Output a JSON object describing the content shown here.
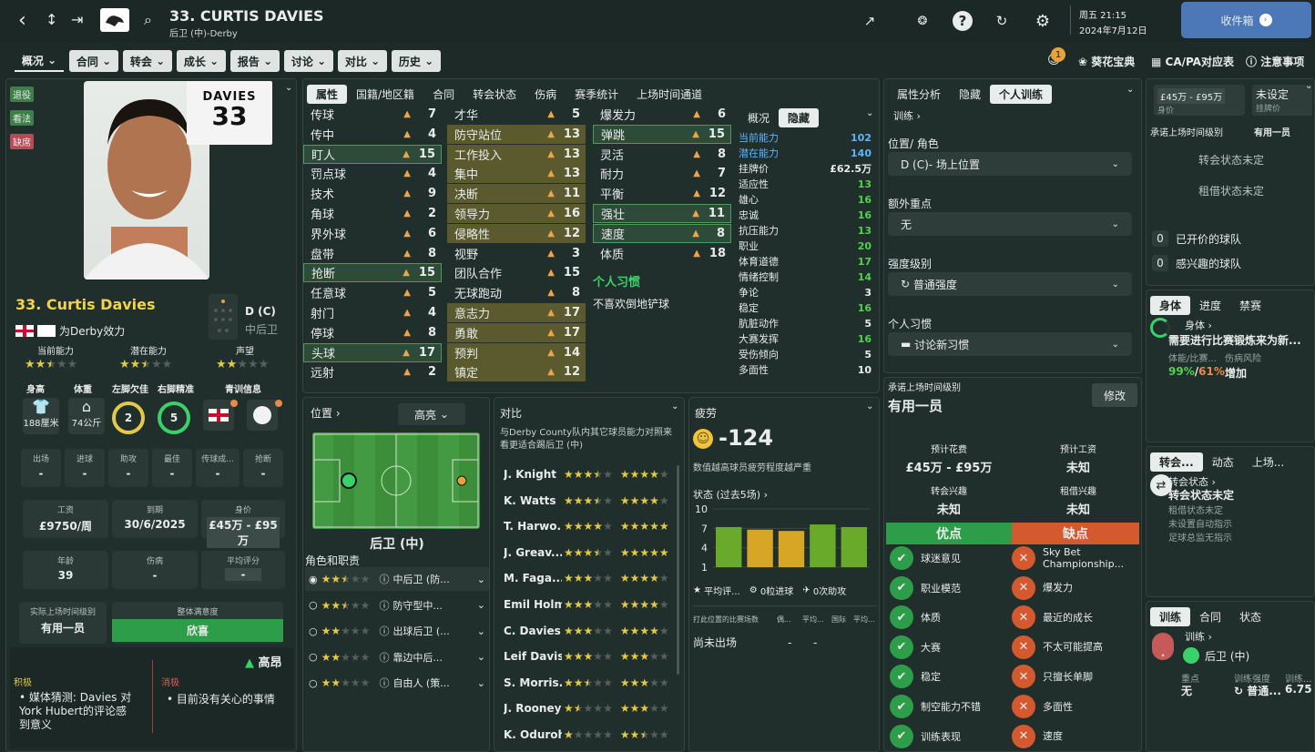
{
  "header": {
    "title": "33. CURTIS DAVIES",
    "subtitle": "后卫 (中)-Derby",
    "day_time": "周五 21:15",
    "date": "2024年7月12日",
    "inbox": "收件箱"
  },
  "menu": {
    "items": [
      "概况",
      "合同",
      "转会",
      "成长",
      "报告",
      "讨论",
      "对比",
      "历史"
    ],
    "right_badge": "1",
    "right_links": [
      "葵花宝典",
      "CA/PA对应表",
      "注意事项"
    ]
  },
  "left_tags": [
    "退役",
    "看法",
    "缺席"
  ],
  "player": {
    "shirt_name": "DAVIES",
    "shirt_number": "33",
    "name": "33. Curtis Davies",
    "club_line": "为Derby效力",
    "position": "D (C)",
    "position_sub": "中后卫",
    "ability_labels": [
      "当前能力",
      "潜在能力",
      "声望"
    ],
    "ability_stars": [
      2.5,
      2.5,
      2
    ],
    "info_labels": [
      "身高",
      "体重",
      "左脚欠佳",
      "右脚精准",
      "青训信息"
    ],
    "height": "188厘米",
    "weight": "74公斤",
    "left_foot": "2",
    "right_foot": "5",
    "stats_labels": [
      "出场",
      "进球",
      "助攻",
      "最佳",
      "传球成...",
      "抢断"
    ],
    "stats_values": [
      "-",
      "-",
      "-",
      "-",
      "-",
      "-"
    ],
    "wage_label": "工资",
    "wage": "£9750/周",
    "expiry_label": "到期",
    "expiry": "30/6/2025",
    "value_label": "身价",
    "value": "£45万 - £95万",
    "age_label": "年龄",
    "age": "39",
    "injury_label": "伤病",
    "injury": "-",
    "rating_label": "平均评分",
    "rating": "-",
    "playtime_label": "实际上场时间级别",
    "playtime": "有用一员",
    "satisfaction_label": "整体满意度",
    "satisfaction": "欣喜",
    "morale": "高昂",
    "positive_label": "积极",
    "positive_item": "媒体猜测: Davies 对York Hubert的评论感到意义",
    "negative_label": "消极",
    "negative_item": "目前没有关心的事情"
  },
  "attr_tabs": [
    "属性",
    "国籍/地区籍",
    "合同",
    "转会状态",
    "伤病",
    "赛季统计",
    "上场时间通道"
  ],
  "technical": [
    [
      "传球",
      "7"
    ],
    [
      "传中",
      "4"
    ],
    [
      "盯人",
      "15"
    ],
    [
      "罚点球",
      "4"
    ],
    [
      "技术",
      "9"
    ],
    [
      "角球",
      "2"
    ],
    [
      "界外球",
      "6"
    ],
    [
      "盘带",
      "8"
    ],
    [
      "抢断",
      "15"
    ],
    [
      "任意球",
      "5"
    ],
    [
      "射门",
      "4"
    ],
    [
      "停球",
      "8"
    ],
    [
      "头球",
      "17"
    ],
    [
      "远射",
      "2"
    ]
  ],
  "mental": [
    [
      "才华",
      "5"
    ],
    [
      "防守站位",
      "13"
    ],
    [
      "工作投入",
      "13"
    ],
    [
      "集中",
      "13"
    ],
    [
      "决断",
      "11"
    ],
    [
      "领导力",
      "16"
    ],
    [
      "侵略性",
      "12"
    ],
    [
      "视野",
      "3"
    ],
    [
      "团队合作",
      "15"
    ],
    [
      "无球跑动",
      "8"
    ],
    [
      "意志力",
      "17"
    ],
    [
      "勇敢",
      "17"
    ],
    [
      "预判",
      "14"
    ],
    [
      "镇定",
      "12"
    ]
  ],
  "physical": [
    [
      "爆发力",
      "6"
    ],
    [
      "弹跳",
      "15"
    ],
    [
      "灵活",
      "8"
    ],
    [
      "耐力",
      "7"
    ],
    [
      "平衡",
      "12"
    ],
    [
      "强壮",
      "11"
    ],
    [
      "速度",
      "8"
    ],
    [
      "体质",
      "18"
    ]
  ],
  "habits": {
    "title": "个人习惯",
    "item": "不喜欢倒地铲球"
  },
  "hidden_tabs": [
    "概况",
    "隐藏"
  ],
  "hidden": [
    [
      "当前能力",
      "102"
    ],
    [
      "潜在能力",
      "140"
    ],
    [
      "挂牌价",
      "£62.5万"
    ],
    [
      "适应性",
      "13"
    ],
    [
      "雄心",
      "16"
    ],
    [
      "忠诚",
      "16"
    ],
    [
      "抗压能力",
      "13"
    ],
    [
      "职业",
      "20"
    ],
    [
      "体育道德",
      "17"
    ],
    [
      "情绪控制",
      "14"
    ],
    [
      "争论",
      "3"
    ],
    [
      "稳定",
      "16"
    ],
    [
      "肮脏动作",
      "5"
    ],
    [
      "大赛发挥",
      "16"
    ],
    [
      "受伤倾向",
      "5"
    ],
    [
      "多面性",
      "10"
    ]
  ],
  "position_panel": {
    "title": "位置",
    "highlight": "高亮",
    "pos_label": "后卫 (中)",
    "roles_title": "角色和职责",
    "roles": [
      [
        "中后卫 (防...",
        2.5
      ],
      [
        "防守型中...",
        2.5
      ],
      [
        "出球后卫 (...",
        2
      ],
      [
        "靠边中后...",
        2
      ],
      [
        "自由人 (策...",
        2
      ]
    ]
  },
  "compare": {
    "title": "对比",
    "desc": "与Derby County队内其它球员能力对照来看更适合踢后卫 (中)",
    "players": [
      [
        "J. Knight",
        3.5,
        4
      ],
      [
        "K. Watts",
        3.5,
        4
      ],
      [
        "T. Harwo...",
        4,
        5
      ],
      [
        "J. Greav...",
        3.5,
        5
      ],
      [
        "M. Faga...",
        3,
        4
      ],
      [
        "Emil Holm",
        3,
        4
      ],
      [
        "C. Davies",
        3,
        4
      ],
      [
        "Leif Davis",
        3,
        3
      ],
      [
        "S. Morris...",
        2.5,
        3
      ],
      [
        "J. Rooney",
        1.5,
        3
      ],
      [
        "K. Oduroh",
        1,
        2.5
      ]
    ]
  },
  "fatigue": {
    "title": "疲劳",
    "value": "-124",
    "desc": "数值越高球员疲劳程度越严重",
    "form_label": "状态 (过去5场)",
    "chart_data": {
      "type": "bar",
      "categories": [
        "1",
        "2",
        "3",
        "4",
        "5"
      ],
      "values": [
        7.2,
        6.8,
        6.6,
        7.6,
        7.2
      ],
      "ylim": [
        1,
        10
      ],
      "ticks": [
        "10",
        "7",
        "4",
        "1"
      ]
    },
    "avg_rating": "平均评...",
    "goals": "0粒进球",
    "assists": "0次助攻",
    "recent_header": [
      "打此位置的比赛场数",
      "偶...",
      "平均...",
      "国际",
      "平均..."
    ],
    "recent_row": [
      "尚未出场",
      "-",
      "-"
    ]
  },
  "training": {
    "tabs": [
      "属性分析",
      "隐藏",
      "个人训练"
    ],
    "link": "训练",
    "pos_label": "位置/ 角色",
    "pos_value": "D (C)- 场上位置",
    "extra_label": "额外重点",
    "extra_value": "无",
    "intensity_label": "强度级别",
    "intensity_value": "普通强度",
    "habit_label": "个人习惯",
    "habit_value": "讨论新习惯"
  },
  "playtime": {
    "title": "承诺上场时间级别",
    "value": "有用一员",
    "edit": "修改",
    "fee_label": "预计花费",
    "fee": "£45万 - £95万",
    "wage_label": "预计工资",
    "wage": "未知",
    "transfer_interest_label": "转会兴趣",
    "transfer_interest": "未知",
    "loan_interest_label": "租借兴趣",
    "loan_interest": "未知",
    "pros": "优点",
    "cons": "缺点"
  },
  "pros": [
    "球迷意见",
    "职业模范",
    "体质",
    "大赛",
    "稳定",
    "制空能力不错",
    "训练表现"
  ],
  "cons": [
    "Sky Bet Championship...",
    "爆发力",
    "最近的成长",
    "不太可能提高",
    "只擅长单脚",
    "多面性",
    "速度"
  ],
  "right": {
    "value": "£45万 - £95万",
    "value_label": "身价",
    "not_set": "未设定",
    "listing": "挂牌价",
    "promise_label": "承诺上场时间级别",
    "promise": "有用一员",
    "transfer_status": "转会状态未定",
    "loan_status": "租借状态未定",
    "bids_count": "0",
    "bids": "已开价的球队",
    "interested_count": "0",
    "interested": "感兴趣的球队",
    "body_tabs": [
      "身体",
      "进度",
      "禁赛"
    ],
    "body_title": "身体",
    "body_desc": "需要进行比赛锻炼来为新...",
    "body_sub1": "体能/比赛...",
    "body_sub2": "伤病风险",
    "body_v1": "99%",
    "body_v2": "61%",
    "body_v3": "增加",
    "transfer_tabs": [
      "转会...",
      "动态",
      "上场..."
    ],
    "ts_title": "转会状态",
    "ts_value": "转会状态未定",
    "ts_l1": "租借状态未定",
    "ts_l2": "未设置自动指示",
    "ts_l3": "足球总监无指示",
    "train_tabs": [
      "训练",
      "合同",
      "状态"
    ],
    "train_title": "训练",
    "train_pos": "后卫 (中)",
    "train_focus_label": "重点",
    "train_focus": "无",
    "train_int_label": "训练强度",
    "train_int": "普通...",
    "train_score_label": "训练...",
    "train_score": "6.75"
  }
}
